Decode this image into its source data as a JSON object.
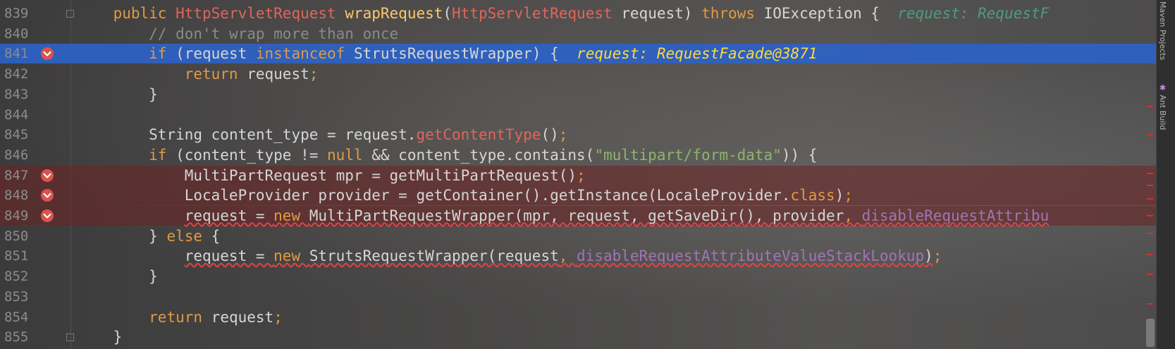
{
  "editor": {
    "lines": [
      {
        "num": "839",
        "state": "normal",
        "tokens": [
          [
            "",
            "    "
          ],
          [
            "kw",
            "public "
          ],
          [
            "cls",
            "HttpServletRequest "
          ],
          [
            "meth",
            "wrapRequest"
          ],
          [
            "type",
            "("
          ],
          [
            "cls",
            "HttpServletRequest"
          ],
          [
            "type",
            " request) "
          ],
          [
            "kw",
            "throws "
          ],
          [
            "type",
            "IOException {  "
          ],
          [
            "hint",
            "request: RequestF"
          ]
        ]
      },
      {
        "num": "840",
        "state": "normal",
        "tokens": [
          [
            "",
            "        "
          ],
          [
            "cmt",
            "// don't wrap more than once"
          ]
        ]
      },
      {
        "num": "841",
        "state": "exec",
        "tokens": [
          [
            "",
            "        "
          ],
          [
            "kw",
            "if "
          ],
          [
            "type",
            "(request "
          ],
          [
            "kw",
            "instanceof "
          ],
          [
            "type",
            "StrutsRequestWrapper) {  "
          ],
          [
            "hint exec",
            "request: RequestFacade@3871"
          ]
        ]
      },
      {
        "num": "842",
        "state": "normal",
        "tokens": [
          [
            "",
            "            "
          ],
          [
            "kw",
            "return "
          ],
          [
            "type",
            "request"
          ],
          [
            "kw",
            ";"
          ]
        ]
      },
      {
        "num": "843",
        "state": "normal",
        "tokens": [
          [
            "",
            "        "
          ],
          [
            "type",
            "}"
          ]
        ]
      },
      {
        "num": "844",
        "state": "normal",
        "tokens": [
          [
            "",
            ""
          ]
        ]
      },
      {
        "num": "845",
        "state": "normal",
        "tokens": [
          [
            "",
            "        "
          ],
          [
            "type",
            "String content_type = request."
          ],
          [
            "redm",
            "getContentType"
          ],
          [
            "type",
            "()"
          ],
          [
            "kw",
            ";"
          ]
        ]
      },
      {
        "num": "846",
        "state": "normal",
        "tokens": [
          [
            "",
            "        "
          ],
          [
            "kw",
            "if "
          ],
          [
            "type",
            "(content_type != "
          ],
          [
            "kw",
            "null "
          ],
          [
            "type",
            "&& content_type.contains("
          ],
          [
            "str",
            "\"multipart/form-data\""
          ],
          [
            "type",
            ")) {"
          ]
        ]
      },
      {
        "num": "847",
        "state": "bp",
        "tokens": [
          [
            "",
            "            "
          ],
          [
            "type",
            "MultiPartRequest mpr = getMultiPartRequest()"
          ],
          [
            "kw",
            ";"
          ]
        ]
      },
      {
        "num": "848",
        "state": "bp",
        "tokens": [
          [
            "",
            "            "
          ],
          [
            "type",
            "LocaleProvider provider = getContainer().getInstance(LocaleProvider."
          ],
          [
            "kw",
            "class"
          ],
          [
            "type",
            ")"
          ],
          [
            "kw",
            ";"
          ]
        ]
      },
      {
        "num": "849",
        "state": "bp",
        "tokens": [
          [
            "",
            "            "
          ],
          [
            "type wavy",
            "request = "
          ],
          [
            "kw wavy",
            "new "
          ],
          [
            "type wavy",
            "MultiPartRequestWrapper(mpr, request, getSaveDir(), provider"
          ],
          [
            "kw wavy",
            ", "
          ],
          [
            "field wavy",
            "disableRequestAttribu"
          ]
        ]
      },
      {
        "num": "850",
        "state": "normal",
        "tokens": [
          [
            "",
            "        "
          ],
          [
            "type",
            "} "
          ],
          [
            "kw",
            "else "
          ],
          [
            "type",
            "{"
          ]
        ]
      },
      {
        "num": "851",
        "state": "normal",
        "tokens": [
          [
            "",
            "            "
          ],
          [
            "type wavy",
            "request = "
          ],
          [
            "kw wavy",
            "new "
          ],
          [
            "type wavy",
            "StrutsRequestWrapper(request"
          ],
          [
            "kw wavy",
            ", "
          ],
          [
            "field wavy",
            "disableRequestAttributeValueStackLookup"
          ],
          [
            "type wavy",
            ")"
          ],
          [
            "kw",
            ";"
          ]
        ]
      },
      {
        "num": "852",
        "state": "normal",
        "tokens": [
          [
            "",
            "        "
          ],
          [
            "type",
            "}"
          ]
        ]
      },
      {
        "num": "853",
        "state": "normal",
        "tokens": [
          [
            "",
            ""
          ]
        ]
      },
      {
        "num": "854",
        "state": "normal",
        "tokens": [
          [
            "",
            "        "
          ],
          [
            "kw",
            "return "
          ],
          [
            "type",
            "request"
          ],
          [
            "kw",
            ";"
          ]
        ]
      },
      {
        "num": "855",
        "state": "normal",
        "tokens": [
          [
            "",
            "    "
          ],
          [
            "type",
            "}"
          ]
        ]
      }
    ]
  },
  "right_toolbar": {
    "maven_label": "Maven Projects",
    "ant_label": "Ant Build"
  },
  "colors": {
    "exec_line": "#2f65ca",
    "breakpoint": "#d9534f",
    "keyword": "#e19a43",
    "hint": "#4d9b83"
  }
}
